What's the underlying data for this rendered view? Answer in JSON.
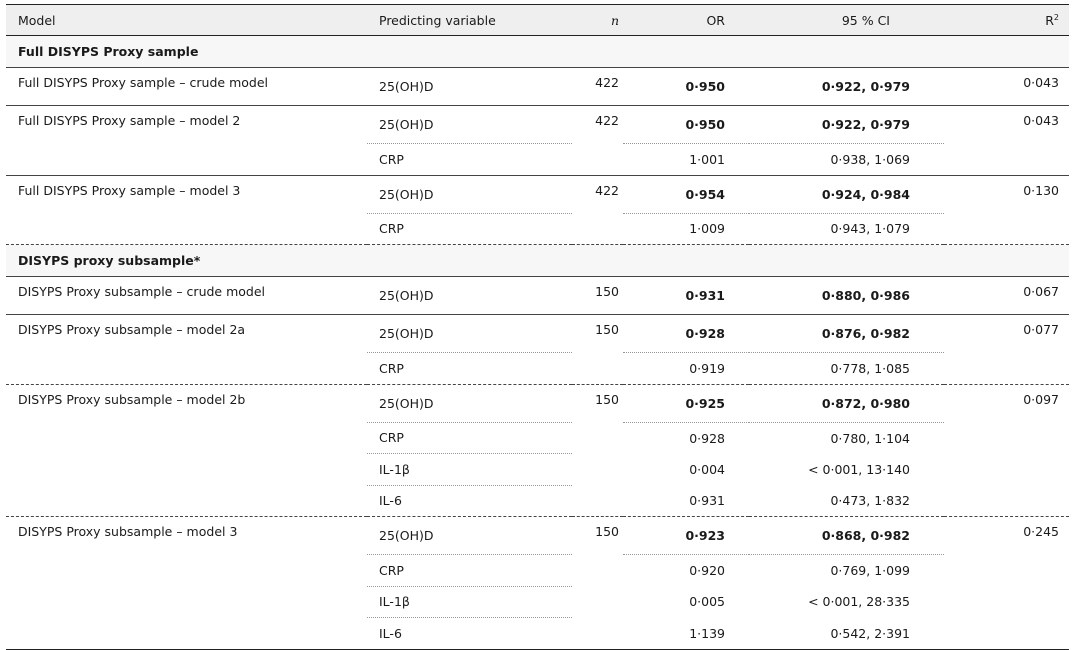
{
  "headers": {
    "model": "Model",
    "predicting_variable": "Predicting variable",
    "n": "n",
    "or": "OR",
    "ci": "95 % CI",
    "r2_base": "R",
    "r2_sup": "2"
  },
  "sections": [
    {
      "title": "Full DISYPS Proxy sample",
      "models": [
        {
          "name": "Full DISYPS Proxy sample – crude model",
          "n": "422",
          "r2": "0·043",
          "rows": [
            {
              "var": "25(OH)D",
              "or": "0·950",
              "ci": "0·922, 0·979",
              "bold": true
            }
          ]
        },
        {
          "name": "Full DISYPS Proxy sample – model 2",
          "n": "422",
          "r2": "0·043",
          "rows": [
            {
              "var": "25(OH)D",
              "or": "0·950",
              "ci": "0·922, 0·979",
              "bold": true
            },
            {
              "var": "CRP",
              "or": "1·001",
              "ci": "0·938, 1·069",
              "bold": false
            }
          ]
        },
        {
          "name": "Full DISYPS Proxy sample – model 3",
          "n": "422",
          "r2": "0·130",
          "rows": [
            {
              "var": "25(OH)D",
              "or": "0·954",
              "ci": "0·924, 0·984",
              "bold": true
            },
            {
              "var": "CRP",
              "or": "1·009",
              "ci": "0·943, 1·079",
              "bold": false
            }
          ]
        }
      ]
    },
    {
      "title": "DISYPS proxy subsample*",
      "models": [
        {
          "name": "DISYPS Proxy subsample – crude model",
          "n": "150",
          "r2": "0·067",
          "rows": [
            {
              "var": "25(OH)D",
              "or": "0·931",
              "ci": "0·880, 0·986",
              "bold": true
            }
          ]
        },
        {
          "name": "DISYPS Proxy subsample – model 2a",
          "n": "150",
          "r2": "0·077",
          "rows": [
            {
              "var": "25(OH)D",
              "or": "0·928",
              "ci": "0·876, 0·982",
              "bold": true
            },
            {
              "var": "CRP",
              "or": "0·919",
              "ci": "0·778, 1·085",
              "bold": false
            }
          ]
        },
        {
          "name": "DISYPS Proxy subsample – model 2b",
          "n": "150",
          "r2": "0·097",
          "rows": [
            {
              "var": "25(OH)D",
              "or": "0·925",
              "ci": "0·872, 0·980",
              "bold": true
            },
            {
              "var": "CRP",
              "or": "0·928",
              "ci": "0·780, 1·104",
              "bold": false
            },
            {
              "var": "IL-1β",
              "or": "0·004",
              "ci": "< 0·001, 13·140",
              "bold": false
            },
            {
              "var": "IL-6",
              "or": "0·931",
              "ci": "0·473, 1·832",
              "bold": false
            }
          ]
        },
        {
          "name": "DISYPS Proxy subsample – model 3",
          "n": "150",
          "r2": "0·245",
          "rows": [
            {
              "var": "25(OH)D",
              "or": "0·923",
              "ci": "0·868, 0·982",
              "bold": true
            },
            {
              "var": "CRP",
              "or": "0·920",
              "ci": "0·769, 1·099",
              "bold": false
            },
            {
              "var": "IL-1β",
              "or": "0·005",
              "ci": "< 0·001, 28·335",
              "bold": false
            },
            {
              "var": "IL-6",
              "or": "1·139",
              "ci": "0·542, 2·391",
              "bold": false
            }
          ]
        }
      ]
    }
  ]
}
